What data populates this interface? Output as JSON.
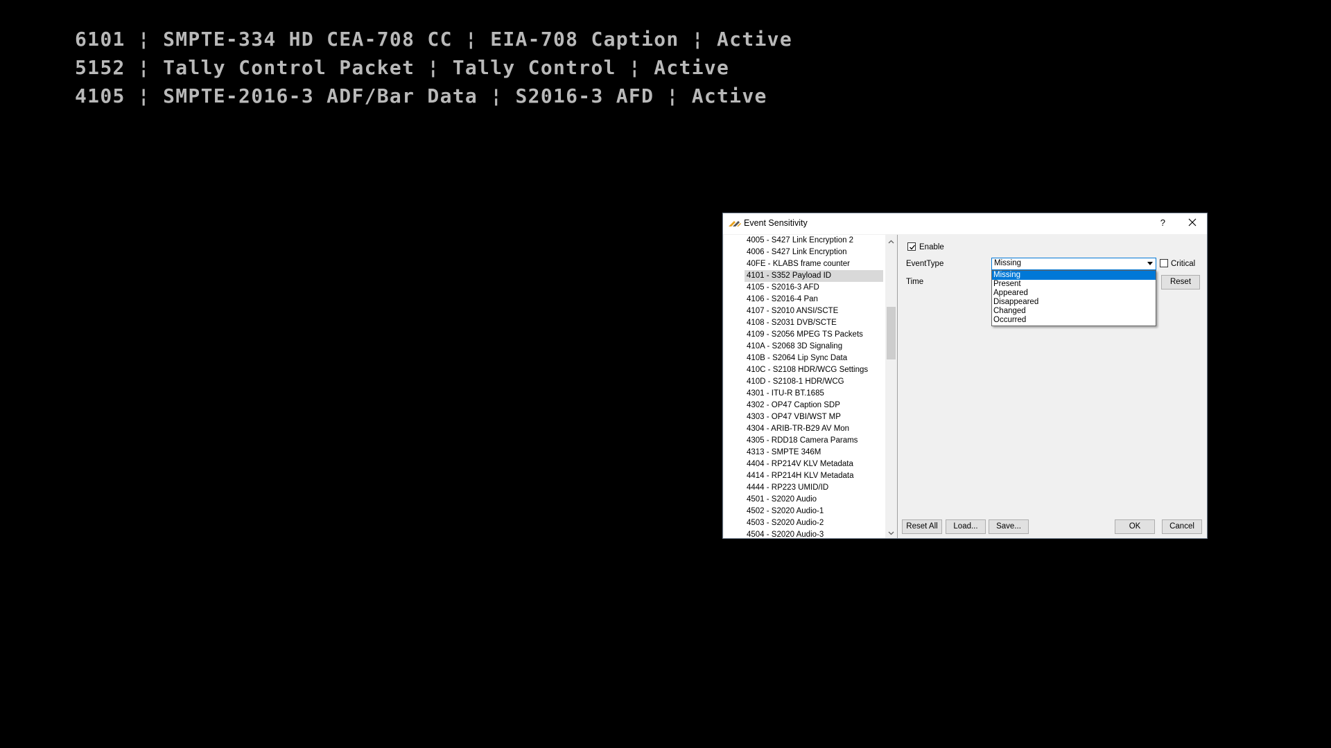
{
  "terminal": {
    "lines": [
      "6101 ¦ SMPTE-334 HD CEA-708 CC ¦ EIA-708 Caption ¦ Active",
      "5152 ¦ Tally Control Packet ¦ Tally Control ¦ Active",
      "4105 ¦ SMPTE-2016-3 ADF/Bar Data ¦ S2016-3 AFD ¦ Active"
    ]
  },
  "dialog": {
    "title": "Event Sensitivity",
    "help_label": "?",
    "list_items": [
      "4005 - S427 Link Encryption 2",
      "4006 - S427 Link Encryption",
      "40FE - KLABS frame counter",
      "4101 - S352 Payload ID",
      "4105 - S2016-3 AFD",
      "4106 - S2016-4 Pan",
      "4107 - S2010 ANSI/SCTE",
      "4108 - S2031 DVB/SCTE",
      "4109 - S2056 MPEG TS Packets",
      "410A - S2068 3D Signaling",
      "410B - S2064 Lip Sync Data",
      "410C - S2108 HDR/WCG Settings",
      "410D - S2108-1 HDR/WCG",
      "4301 - ITU-R BT.1685",
      "4302 - OP47 Caption SDP",
      "4303 - OP47 VBI/WST MP",
      "4304 - ARIB-TR-B29 AV Mon",
      "4305 - RDD18 Camera Params",
      "4313 - SMPTE 346M",
      "4404 - RP214V KLV Metadata",
      "4414 - RP214H KLV Metadata",
      "4444 - RP223 UMID/ID",
      "4501 - S2020 Audio",
      "4502 - S2020 Audio-1",
      "4503 - S2020 Audio-2",
      "4504 - S2020 Audio-3"
    ],
    "selected_item": "4101 - S352 Payload ID",
    "enable_label": "Enable",
    "enable_checked": true,
    "eventtype_label": "EventType",
    "eventtype_value": "Missing",
    "critical_label": "Critical",
    "critical_checked": false,
    "time_label": "Time",
    "reset_label": "Reset",
    "dropdown_options": [
      "Missing",
      "Present",
      "Appeared",
      "Disappeared",
      "Changed",
      "Occurred"
    ],
    "dropdown_highlighted": "Missing",
    "buttons": {
      "reset_all": "Reset All",
      "load": "Load...",
      "save": "Save...",
      "ok": "OK",
      "cancel": "Cancel"
    },
    "colors": {
      "selection_blue": "#0078d7",
      "selected_row": "#d9d9d9"
    }
  }
}
